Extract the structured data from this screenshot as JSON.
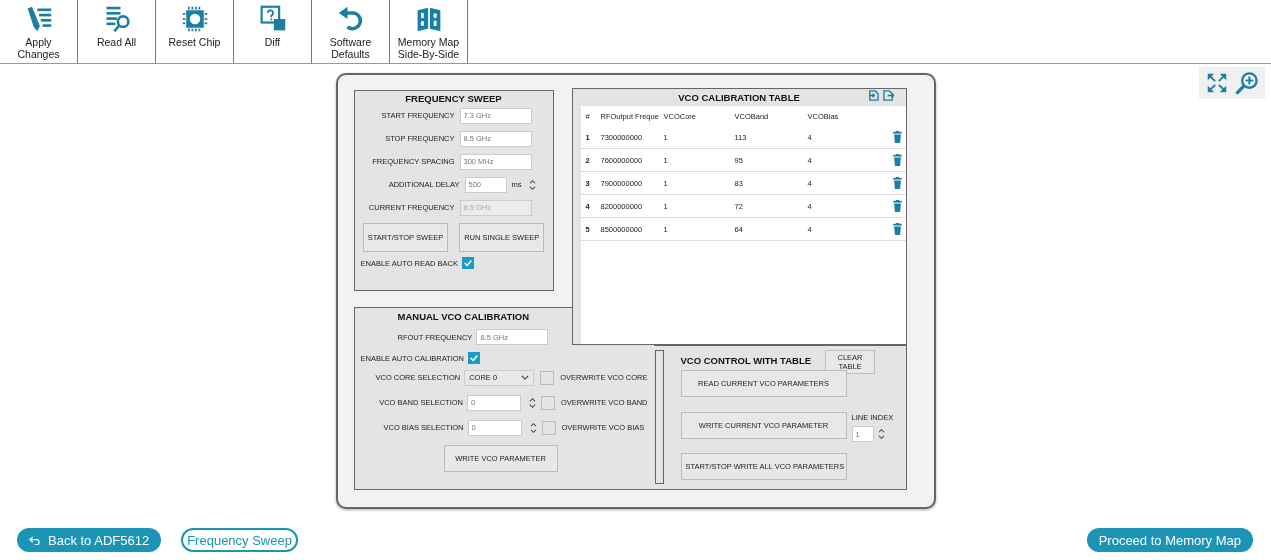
{
  "toolbar": [
    {
      "label": "Apply Changes",
      "kind": "apply"
    },
    {
      "label": "Read All",
      "kind": "read"
    },
    {
      "label": "Reset Chip",
      "kind": "chip"
    },
    {
      "label": "Diff",
      "kind": "diff"
    },
    {
      "label": "Software Defaults",
      "kind": "undo"
    },
    {
      "label": "Memory Map Side-By-Side",
      "kind": "binary"
    }
  ],
  "frequency_sweep": {
    "title": "FREQUENCY SWEEP",
    "fields": [
      {
        "label": "START FREQUENCY",
        "value": "7.3 GHz",
        "kind": "text",
        "disabled": false
      },
      {
        "label": "STOP FREQUENCY",
        "value": "8.5 GHz",
        "kind": "text",
        "disabled": false
      },
      {
        "label": "FREQUENCY SPACING",
        "value": "300 MHz",
        "kind": "text",
        "disabled": false
      },
      {
        "label": "ADDITIONAL DELAY",
        "value": "500",
        "unit": "ms",
        "kind": "spinner",
        "disabled": false
      },
      {
        "label": "CURRENT FREQUENCY",
        "value": "8.5 GHz",
        "kind": "text",
        "disabled": true
      }
    ],
    "buttons": [
      "START/STOP SWEEP",
      "RUN SINGLE SWEEP"
    ],
    "auto_read_back": {
      "label": "ENABLE AUTO READ BACK",
      "checked": true
    }
  },
  "calibration_table": {
    "title": "VCO CALIBRATION TABLE",
    "columns": [
      "#",
      "RFOutput Freque",
      "VCOCore",
      "VCOBand",
      "VCOBias"
    ],
    "rows": [
      [
        "1",
        "7300000000",
        "1",
        "113",
        "4"
      ],
      [
        "2",
        "7600000000",
        "1",
        "95",
        "4"
      ],
      [
        "3",
        "7900000000",
        "1",
        "83",
        "4"
      ],
      [
        "4",
        "8200000000",
        "1",
        "72",
        "4"
      ],
      [
        "5",
        "8500000000",
        "1",
        "64",
        "4"
      ]
    ]
  },
  "manual_calibration": {
    "title": "MANUAL VCO CALIBRATION",
    "rfout": {
      "label": "RFOUT FREQUENCY",
      "value": "8.5 GHz"
    },
    "auto_calibration": {
      "label": "ENABLE AUTO CALIBRATION",
      "checked": true
    },
    "selections": [
      {
        "label": "VCO CORE SELECTION",
        "kind": "dropdown",
        "value": "CORE 0",
        "overwrite": {
          "label": "OVERWRITE VCO CORE",
          "checked": false
        }
      },
      {
        "label": "VCO BAND SELECTION",
        "kind": "spinner",
        "value": "0",
        "overwrite": {
          "label": "OVERWRITE VCO BAND",
          "checked": false
        }
      },
      {
        "label": "VCO BIAS SELECTION",
        "kind": "spinner",
        "value": "0",
        "overwrite": {
          "label": "OVERWRITE VCO BIAS",
          "checked": false
        }
      }
    ],
    "button": "WRITE VCO PARAMETER"
  },
  "vco_control": {
    "title": "VCO CONTROL WITH TABLE",
    "clear_button": "CLEAR TABLE",
    "buttons": [
      "READ CURRENT VCO PARAMETERS",
      "WRITE CURRENT VCO PARAMETER",
      "START/STOP WRITE ALL VCO PARAMETERS"
    ],
    "line_index": {
      "label": "LINE INDEX",
      "value": "1"
    }
  },
  "footer": {
    "back_button": "Back to ADF5612",
    "sweep_button": "Frequency Sweep",
    "proceed_button": "Proceed to Memory Map"
  }
}
